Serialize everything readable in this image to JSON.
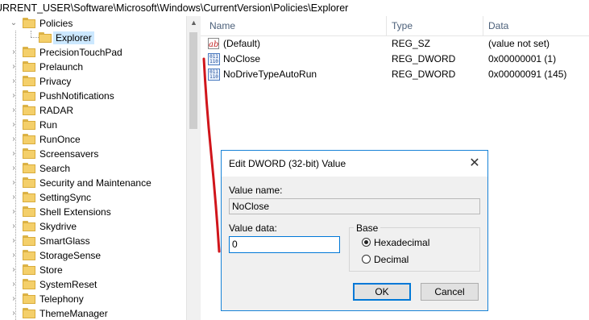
{
  "address_bar": "URRENT_USER\\Software\\Microsoft\\Windows\\CurrentVersion\\Policies\\Explorer",
  "tree": {
    "parent": "Policies",
    "selected": "Explorer",
    "items": [
      "PrecisionTouchPad",
      "Prelaunch",
      "Privacy",
      "PushNotifications",
      "RADAR",
      "Run",
      "RunOnce",
      "Screensavers",
      "Search",
      "Security and Maintenance",
      "SettingSync",
      "Shell Extensions",
      "Skydrive",
      "SmartGlass",
      "StorageSense",
      "Store",
      "SystemReset",
      "Telephony",
      "ThemeManager"
    ]
  },
  "list": {
    "headers": {
      "name": "Name",
      "type": "Type",
      "data": "Data"
    },
    "rows": [
      {
        "icon": "string-value-icon",
        "name": "(Default)",
        "type": "REG_SZ",
        "data": "(value not set)"
      },
      {
        "icon": "binary-value-icon",
        "name": "NoClose",
        "type": "REG_DWORD",
        "data": "0x00000001 (1)"
      },
      {
        "icon": "binary-value-icon",
        "name": "NoDriveTypeAutoRun",
        "type": "REG_DWORD",
        "data": "0x00000091 (145)"
      }
    ]
  },
  "dialog": {
    "title": "Edit DWORD (32-bit) Value",
    "value_name_label": "Value name:",
    "value_name": "NoClose",
    "value_data_label": "Value data:",
    "value_data": "0",
    "base_label": "Base",
    "base_options": [
      {
        "label": "Hexadecimal",
        "selected": true
      },
      {
        "label": "Decimal",
        "selected": false
      }
    ],
    "ok_label": "OK",
    "cancel_label": "Cancel"
  },
  "colors": {
    "annotation_line": "#d0151b",
    "selection": "#cce8ff",
    "accent": "#0078d7"
  }
}
